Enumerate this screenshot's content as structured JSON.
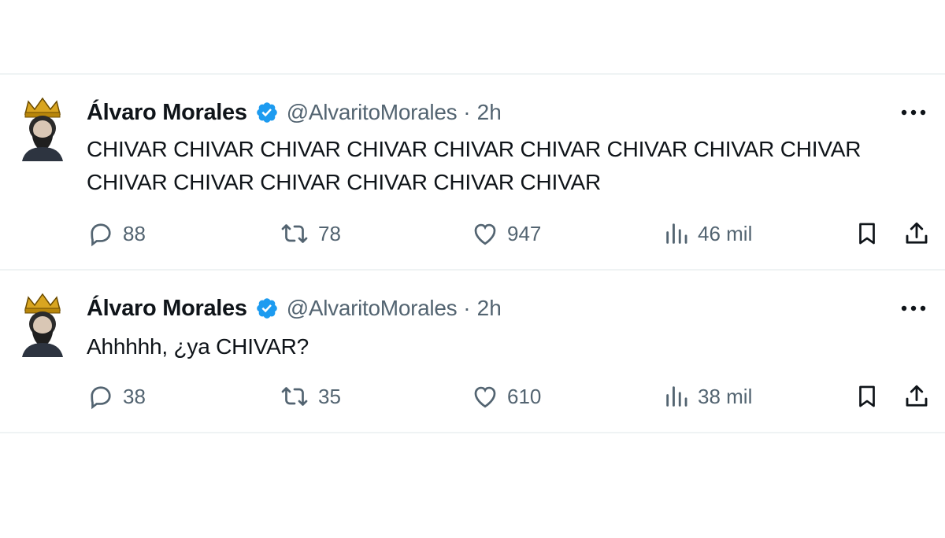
{
  "colors": {
    "text_primary": "#0f1419",
    "text_secondary": "#536471",
    "verified_blue": "#1d9bf0",
    "divider": "#eff3f4"
  },
  "tweets": [
    {
      "author_name": "Álvaro Morales",
      "verified_icon": "verified-badge-icon",
      "handle": "@AlvaritoMorales",
      "separator": "·",
      "time": "2h",
      "text": "CHIVAR CHIVAR CHIVAR CHIVAR CHIVAR CHIVAR CHIVAR CHIVAR CHIVAR CHIVAR CHIVAR CHIVAR CHIVAR CHIVAR CHIVAR",
      "replies": "88",
      "retweets": "78",
      "likes": "947",
      "views": "46 mil"
    },
    {
      "author_name": "Álvaro Morales",
      "verified_icon": "verified-badge-icon",
      "handle": "@AlvaritoMorales",
      "separator": "·",
      "time": "2h",
      "text": "Ahhhhh, ¿ya CHIVAR?",
      "replies": "38",
      "retweets": "35",
      "likes": "610",
      "views": "38 mil"
    }
  ]
}
